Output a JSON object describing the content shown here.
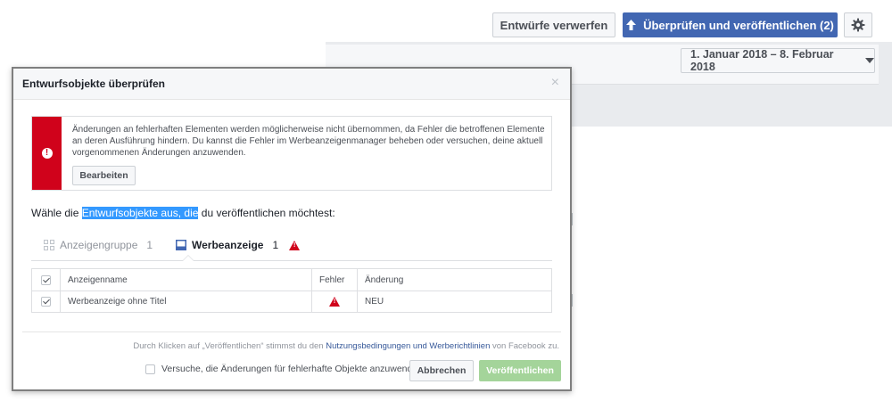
{
  "toolbar": {
    "discard_label": "Entwürfe verwerfen",
    "review_label": "Überprüfen und veröffentlichen (2)",
    "review_icon": "arrow-up-icon",
    "settings_icon": "gear-icon",
    "date_range": "1. Januar 2018 – 8. Februar 2018"
  },
  "dialog": {
    "title": "Entwurfsobjekte überprüfen",
    "close_glyph": "×",
    "alert": {
      "text": "Änderungen an fehlerhaften Elementen werden möglicherweise nicht übernommen, da Fehler die betroffenen Elemente an deren Ausführung hindern. Du kannst die Fehler im Werbeanzeigenmanager beheben oder versuchen, deine aktuell vorgenommenen Änderungen anzuwenden.",
      "edit_label": "Bearbeiten",
      "color": "#d0021b"
    },
    "choose": {
      "before": "Wähle die ",
      "highlighted": "Entwurfsobjekte aus, die",
      "after": " du veröffentlichen möchtest:"
    },
    "tabs": [
      {
        "label": "Anzeigengruppe",
        "count": "1"
      },
      {
        "label": "Werbeanzeige",
        "count": "1"
      }
    ],
    "table": {
      "headers": [
        "Anzeigenname",
        "Fehler",
        "Änderung"
      ],
      "rows": [
        {
          "name": "Werbeanzeige ohne Titel",
          "change": "NEU"
        }
      ]
    },
    "footer": {
      "terms_prefix": "Durch Klicken auf „Veröffentlichen“ stimmst du den ",
      "terms_link": "Nutzungsbedingungen und Werberichtlinien",
      "terms_suffix": " von Facebook zu.",
      "apply_label": "Versuche, die Änderungen für fehlerhafte Objekte anzuwenden",
      "cancel_label": "Abbrechen",
      "publish_label": "Veröffentlichen"
    }
  }
}
